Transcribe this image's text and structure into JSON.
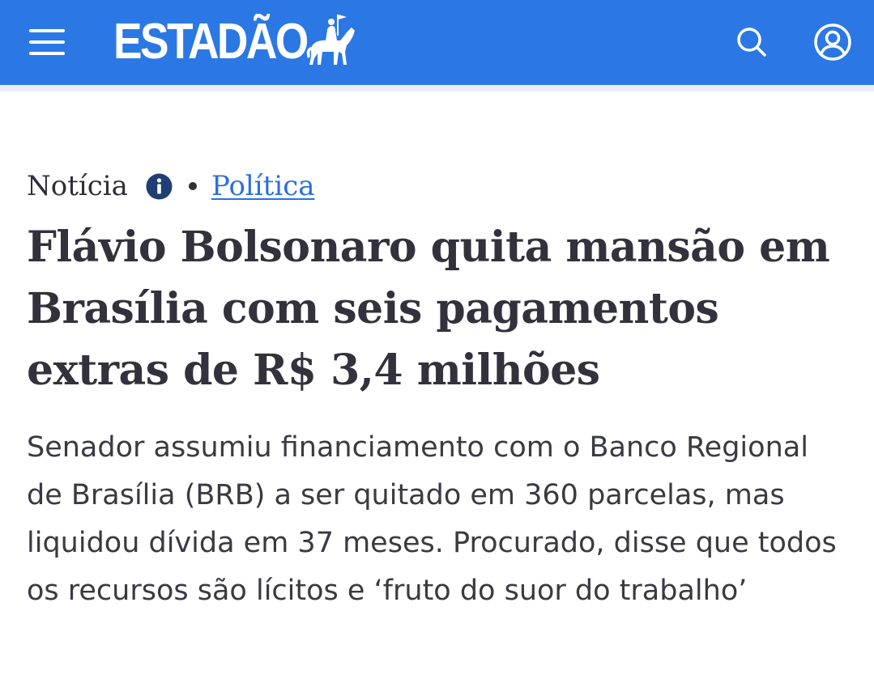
{
  "header": {
    "brand": "ESTADÃO",
    "menu_icon": "hamburger-menu-icon",
    "search_icon": "search-icon",
    "account_icon": "user-account-icon",
    "background_color": "#2b78e4"
  },
  "article": {
    "kicker": "Notícia",
    "info_icon": "info-icon",
    "section": "Política",
    "section_color": "#2b6fe0",
    "headline": "Flávio Bolsonaro quita mansão em Brasília com seis pagamentos extras de R$ 3,4 milhões",
    "subheadline": "Senador assumiu financiamento com o Banco Regional de Brasília (BRB) a ser quitado em 360 parcelas, mas liquidou dívida em 37 meses. Procurado, disse que todos os recursos são lícitos e ‘fruto do suor do trabalho’"
  }
}
